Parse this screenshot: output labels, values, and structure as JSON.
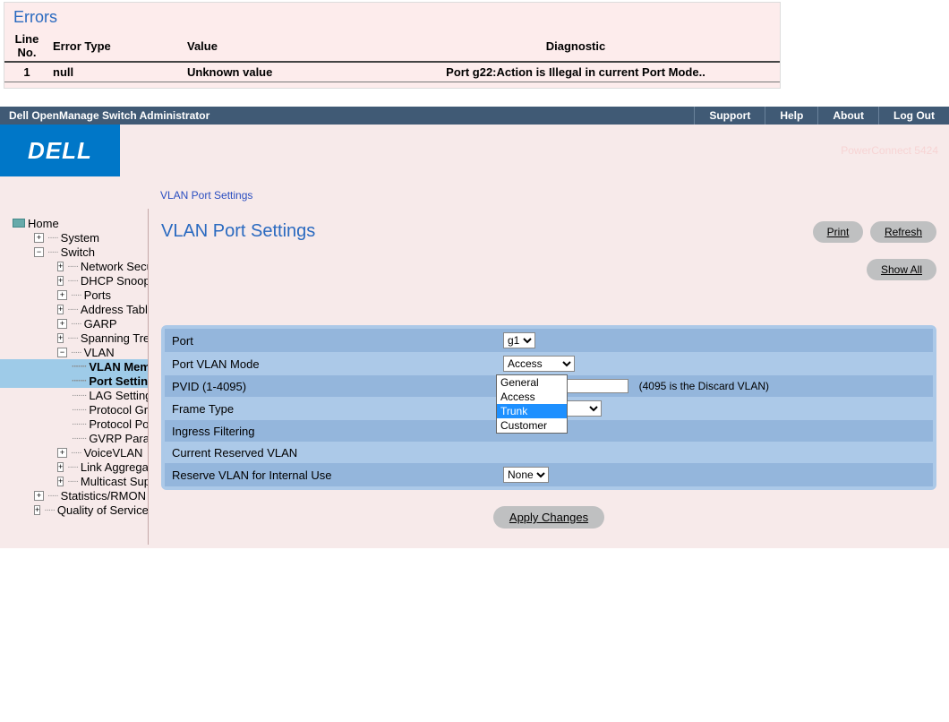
{
  "errors": {
    "title": "Errors",
    "headers": {
      "line": "Line No.",
      "type": "Error Type",
      "value": "Value",
      "diag": "Diagnostic"
    },
    "rows": [
      {
        "line": "1",
        "type": "null",
        "value": "Unknown value",
        "diag": "Port g22:Action is Illegal in current Port Mode.."
      }
    ]
  },
  "topbar": {
    "title": "Dell OpenManage Switch Administrator",
    "links": {
      "support": "Support",
      "help": "Help",
      "about": "About",
      "logout": "Log Out"
    }
  },
  "brand": {
    "logo": "DELL",
    "model": "PowerConnect 5424"
  },
  "tree": {
    "home": "Home",
    "system": "System",
    "switch": "Switch",
    "netsec": "Network Securit",
    "dhcp": "DHCP Snooping",
    "ports": "Ports",
    "addr": "Address Tables",
    "garp": "GARP",
    "stp": "Spanning Tree",
    "vlan": "VLAN",
    "vlanmemb": "VLAN Memb",
    "portset": "Port Setting",
    "lag": "LAG Setting",
    "protgrp": "Protocol Gro",
    "protport": "Protocol Por",
    "gvrp": "GVRP Paran",
    "voicevlan": "VoiceVLAN",
    "linkagg": "Link Aggregation",
    "mcast": "Multicast Suppo",
    "stats": "Statistics/RMON",
    "qos": "Quality of Service"
  },
  "breadcrumb": "VLAN Port Settings",
  "page": {
    "title": "VLAN Port Settings",
    "buttons": {
      "print": "Print",
      "refresh": "Refresh",
      "showall": "Show All",
      "apply": "Apply Changes"
    }
  },
  "form": {
    "port_label": "Port",
    "port_value": "g1",
    "mode_label": "Port VLAN Mode",
    "mode_value": "Access",
    "mode_options": [
      "General",
      "Access",
      "Trunk",
      "Customer"
    ],
    "mode_highlight": "Trunk",
    "pvid_label": "PVID (1-4095)",
    "pvid_value": "",
    "pvid_note": "(4095 is the Discard VLAN)",
    "frame_label": "Frame Type",
    "ingress_label": "Ingress Filtering",
    "reserved_label": "Current Reserved VLAN",
    "reserve_label": "Reserve VLAN for Internal Use",
    "reserve_value": "None"
  }
}
